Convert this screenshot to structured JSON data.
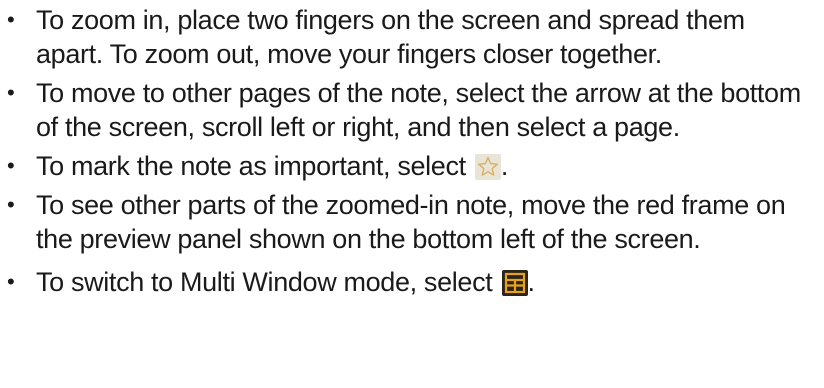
{
  "bullets": [
    {
      "text": "To zoom in, place two fingers on the screen and spread them apart. To zoom out, move your fingers closer together."
    },
    {
      "text": "To move to other pages of the note, select the arrow at the bottom of the screen, scroll left or right, and then select a page."
    },
    {
      "text": "To mark the note as important, select",
      "suffix": ".",
      "icon": "star-outline-icon"
    },
    {
      "text": "To see other parts of the zoomed-in note, move the red frame on the preview panel shown on the bottom left of the screen."
    },
    {
      "text": "To switch to Multi Window mode, select",
      "suffix": ".",
      "icon": "multi-window-icon"
    }
  ],
  "bullet_char": "•",
  "colors": {
    "text": "#1a1a1a",
    "star_icon_bg": "#e9e4d8",
    "star_icon_stroke": "#d9b15c",
    "multi_window_icon_bg": "#2c2417",
    "multi_window_icon_fg": "#e6a21c"
  }
}
